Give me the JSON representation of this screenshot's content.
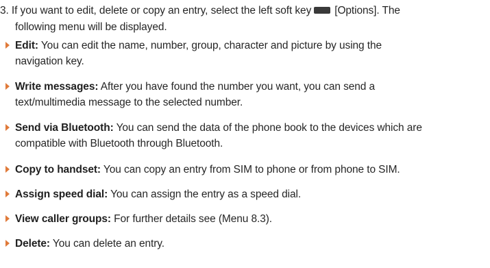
{
  "intro": {
    "line1_before": "3. If you want to edit, delete or copy an entry, select the left soft key",
    "line1_after": "[Options]. The",
    "line2": "following menu will be displayed.",
    "softkey_icon": "left-soft-key-icon"
  },
  "items": [
    {
      "label": "Edit:",
      "line1": " You can edit the name, number, group, character and picture by using the",
      "line2": "navigation key."
    },
    {
      "label": "Write messages:",
      "line1": " After you have found the number you want, you can send a",
      "line2": "text/multimedia message to the selected number."
    },
    {
      "label": "Send via Bluetooth:",
      "line1": " You can send the data of the phone book to the devices which are",
      "line2": "compatible with Bluetooth through Bluetooth."
    },
    {
      "label": "Copy to handset:",
      "line1": " You can copy an entry from SIM to phone or from phone to SIM.",
      "line2": ""
    },
    {
      "label": "Assign speed dial:",
      "line1": " You can assign the entry as a speed dial.",
      "line2": ""
    },
    {
      "label": "View caller groups:",
      "line1": " For further details see (Menu 8.3).",
      "line2": ""
    },
    {
      "label": "Delete:",
      "line1": " You can delete an entry.",
      "line2": ""
    }
  ],
  "colors": {
    "bullet": "#e07a3a",
    "text": "#262626"
  }
}
